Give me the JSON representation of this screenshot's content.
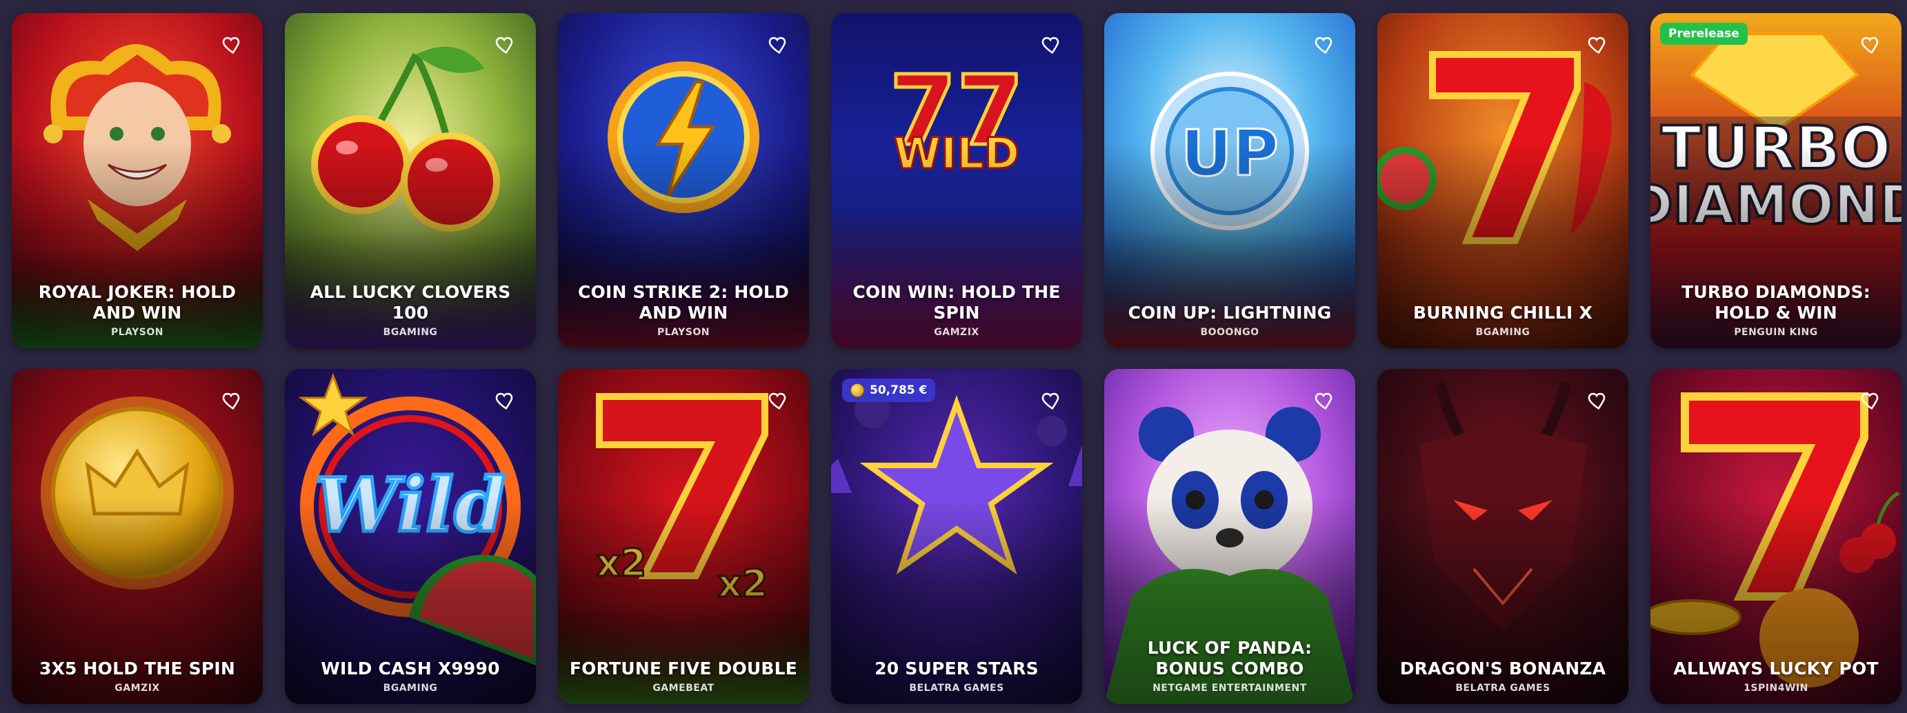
{
  "games": [
    {
      "title": "ROYAL JOKER: HOLD AND WIN",
      "provider": "PLAYSON"
    },
    {
      "title": "ALL LUCKY CLOVERS 100",
      "provider": "BGAMING"
    },
    {
      "title": "COIN STRIKE 2: HOLD AND WIN",
      "provider": "PLAYSON"
    },
    {
      "title": "COIN WIN: HOLD THE SPIN",
      "provider": "GAMZIX"
    },
    {
      "title": "COIN UP: LIGHTNING",
      "provider": "BOOONGO"
    },
    {
      "title": "BURNING CHILLI X",
      "provider": "BGAMING"
    },
    {
      "title": "TURBO DIAMONDS: HOLD & WIN",
      "provider": "PENGUIN KING",
      "badge": "Prerelease"
    },
    {
      "title": "3X5 HOLD THE SPIN",
      "provider": "GAMZIX"
    },
    {
      "title": "WILD CASH X9990",
      "provider": "BGAMING"
    },
    {
      "title": "FORTUNE FIVE DOUBLE",
      "provider": "GAMEBEAT"
    },
    {
      "title": "20 SUPER STARS",
      "provider": "BELATRA GAMES",
      "jackpot": "50,785 €"
    },
    {
      "title": "LUCK OF PANDA: BONUS COMBO",
      "provider": "NETGAME ENTERTAINMENT"
    },
    {
      "title": "DRAGON'S BONANZA",
      "provider": "BELATRA GAMES"
    },
    {
      "title": "ALLWAYS LUCKY POT",
      "provider": "1SPIN4WIN"
    }
  ],
  "art_text": {
    "wild_logo": "WILD",
    "coin_up": "UP",
    "turbo_line1": "TURBO",
    "turbo_line2": "DIAMOND",
    "wild_neon": "Wild",
    "x2": "x2"
  },
  "icons": {
    "favorite": "heart-outline-icon",
    "jackpot": "coin-icon"
  },
  "colors": {
    "page_background": "#2a2640",
    "prerelease_badge": "#22c24a",
    "jackpot_badge": "#3a35c9"
  }
}
